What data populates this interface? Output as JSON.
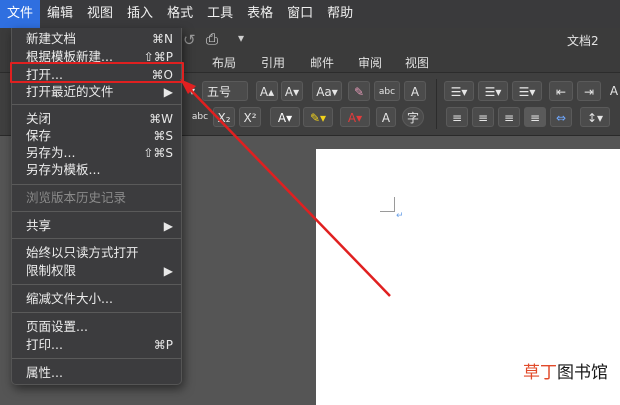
{
  "menubar": {
    "items": [
      "文件",
      "编辑",
      "视图",
      "插入",
      "格式",
      "工具",
      "表格",
      "窗口",
      "帮助"
    ]
  },
  "titlebar": {
    "doc_title": "文档2",
    "undo_icon": "↺",
    "print_icon": "⎙",
    "more_icon": "▾"
  },
  "ribbon_tabs": [
    "布局",
    "引用",
    "邮件",
    "审阅",
    "视图"
  ],
  "ribbon": {
    "font_size": "五号",
    "grow_font": "A▴",
    "shrink_font": "A▾",
    "change_case": "Aa▾",
    "clear_format": "✎",
    "phonetic": "abc",
    "char_border": "A",
    "subscript": "X₂",
    "superscript": "X²",
    "text_effects": "A▾",
    "highlight": "✎▾",
    "font_color": "A▾",
    "char_shading": "A",
    "enclose": "字",
    "strike": "abc",
    "left_fragment": "▾",
    "list_icons": [
      "☰▾",
      "☰▾",
      "☰▾"
    ],
    "indent_icons": [
      "⇤",
      "⇥"
    ],
    "align_icons": [
      "≡",
      "≡",
      "≡",
      "≡",
      "⇔",
      "↕▾"
    ],
    "right_fragment": "A"
  },
  "file_menu": {
    "items": [
      {
        "label": "新建文档",
        "shortcut": "⌘N"
      },
      {
        "label": "根据模板新建...",
        "shortcut": "⇧⌘P"
      },
      {
        "label": "打开...",
        "shortcut": "⌘O"
      },
      {
        "label": "打开最近的文件",
        "shortcut": "▶"
      },
      {
        "label": "关闭",
        "shortcut": "⌘W"
      },
      {
        "label": "保存",
        "shortcut": "⌘S"
      },
      {
        "label": "另存为...",
        "shortcut": "⇧⌘S"
      },
      {
        "label": "另存为模板...",
        "shortcut": ""
      },
      {
        "label": "浏览版本历史记录",
        "shortcut": "",
        "disabled": true
      },
      {
        "label": "共享",
        "shortcut": "▶"
      },
      {
        "label": "始终以只读方式打开",
        "shortcut": ""
      },
      {
        "label": "限制权限",
        "shortcut": "▶"
      },
      {
        "label": "缩减文件大小...",
        "shortcut": ""
      },
      {
        "label": "页面设置...",
        "shortcut": ""
      },
      {
        "label": "打印...",
        "shortcut": "⌘P"
      },
      {
        "label": "属性...",
        "shortcut": ""
      }
    ]
  },
  "colors": {
    "accent": "#2f6fe0",
    "annotation": "#e02020"
  },
  "watermark": {
    "part1": "草丁",
    "part2": "图书馆"
  }
}
